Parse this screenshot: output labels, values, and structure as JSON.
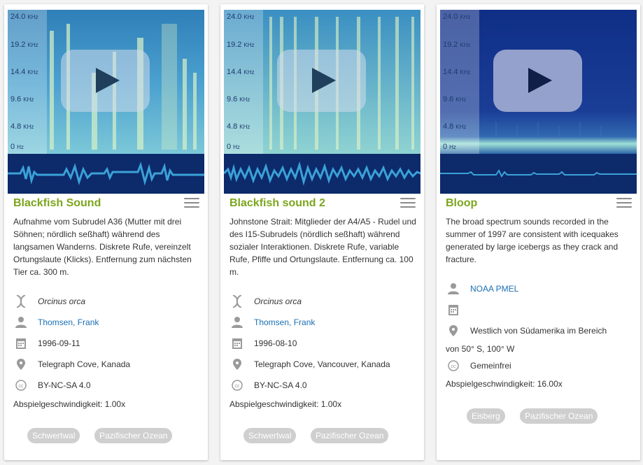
{
  "axis": {
    "ticks": [
      {
        "value": "24.0",
        "unit": "KHz"
      },
      {
        "value": "19.2",
        "unit": "KHz"
      },
      {
        "value": "14.4",
        "unit": "KHz"
      },
      {
        "value": "9.6",
        "unit": "KHz"
      },
      {
        "value": "4.8",
        "unit": "KHz"
      },
      {
        "value": "0",
        "unit": "Hz"
      }
    ]
  },
  "cards": [
    {
      "title": "Blackfish Sound",
      "description": "Aufnahme vom Subrudel A36 (Mutter mit drei Söhnen; nördlich seßhaft) während des langsamen Wanderns. Diskrete Rufe, vereinzelt Ortungslaute (Klicks). Entfernung zum nächsten Tier ca. 300 m.",
      "species": "Orcinus orca",
      "author": "Thomsen, Frank",
      "date": "1996-09-11",
      "location": "Telegraph Cove, Kanada",
      "license": "BY-NC-SA 4.0",
      "speed": "Abspielgeschwindigkeit: 1.00x",
      "tags": [
        "Schwertwal",
        "Pazifischer Ozean"
      ]
    },
    {
      "title": "Blackfish sound 2",
      "description": "Johnstone Strait: Mitglieder der A4/A5 - Rudel und des I15-Subrudels (nördlich seßhaft) während sozialer Interaktionen. Diskrete Rufe, variable Rufe, Pfiffe und Ortungslaute. Entfernung ca. 100 m.",
      "species": "Orcinus orca",
      "author": "Thomsen, Frank",
      "date": "1996-08-10",
      "location": "Telegraph Cove, Vancouver, Kanada",
      "license": "BY-NC-SA 4.0",
      "speed": "Abspielgeschwindigkeit: 1.00x",
      "tags": [
        "Schwertwal",
        "Pazifischer Ozean"
      ]
    },
    {
      "title": "Bloop",
      "description": "The broad spectrum sounds recorded in the summer of 1997 are consistent with icequakes generated by large icebergs as they crack and fracture.",
      "author": "NOAA PMEL",
      "location_line1": "Westlich von Südamerika im Bereich",
      "location_line2": "von 50° S, 100° W",
      "license": "Gemeinfrei",
      "speed": "Abspielgeschwindigkeit: 16.00x",
      "tags": [
        "Eisberg",
        "Pazifischer Ozean"
      ]
    }
  ],
  "colors": {
    "title_green": "#7ba51d",
    "link_blue": "#1a6fb4",
    "tag_gray": "#cfcfcf",
    "wave_bg": "#0d2a6b"
  },
  "icons": [
    "dna-icon",
    "person-icon",
    "calendar-icon",
    "location-pin-icon",
    "cc-license-icon",
    "menu-icon",
    "play-icon"
  ]
}
